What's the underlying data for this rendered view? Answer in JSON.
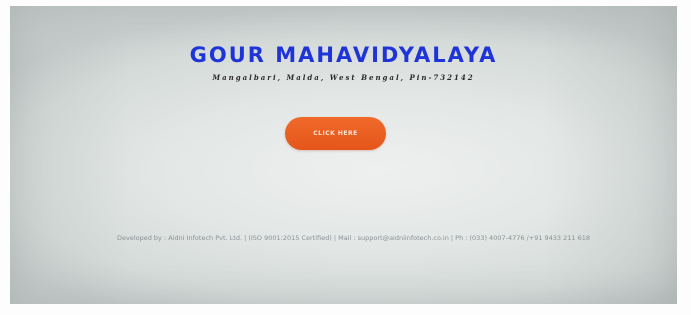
{
  "header": {
    "title": "GOUR MAHAVIDYALAYA",
    "address": "Mangalbari, Malda, West Bengal, Pin-732142"
  },
  "main": {
    "cta_label": "CLICK HERE"
  },
  "footer": {
    "credit": "Developed by : Aidni Infotech Pvt. Ltd. | (ISO 9001:2015 Certified) | Mail : support@aidniinfotech.co.in | Ph : (033) 4007-4776 /+91 9433 211 618"
  },
  "colors": {
    "title": "#1f34d8",
    "button": "#e4551a",
    "footer_text": "#8a9094"
  }
}
